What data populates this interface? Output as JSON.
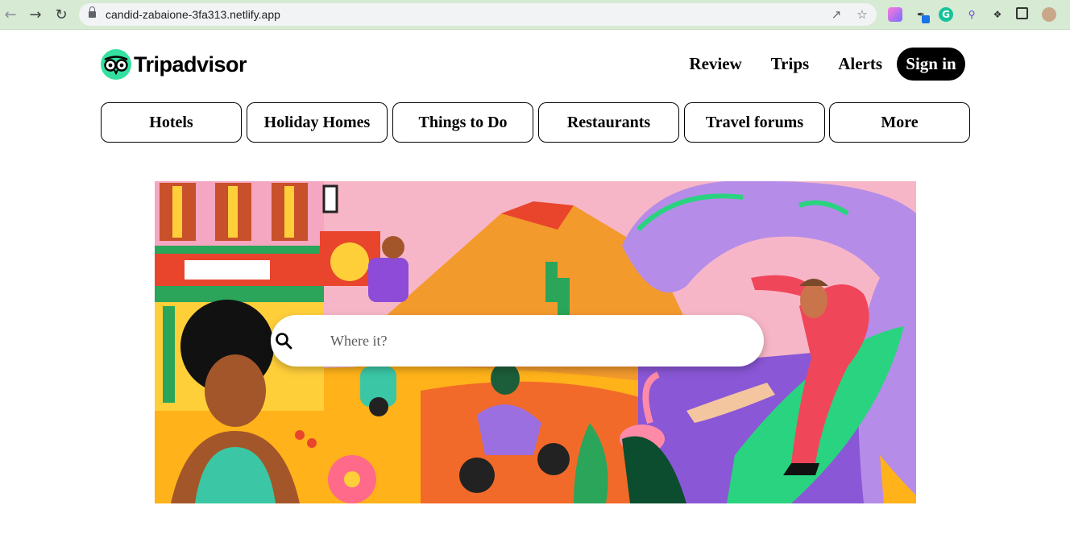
{
  "browser": {
    "url": "candid-zabaione-3fa313.netlify.app",
    "back_icon": "back-arrow-icon",
    "forward_icon": "forward-arrow-icon",
    "reload_icon": "reload-icon",
    "colors": {
      "chrome": "#d6ead4",
      "omnibox": "#f1f3f4"
    }
  },
  "header": {
    "logo_text": "Tripadvisor",
    "logo_color": "#34e0a1",
    "nav": [
      "Review",
      "Trips",
      "Alerts"
    ],
    "signin_label": "Sign in"
  },
  "categories": [
    "Hotels",
    "Holiday Homes",
    "Things to Do",
    "Restaurants",
    "Travel forums",
    "More"
  ],
  "hero": {
    "search_placeholder": "Where it?",
    "search_icon": "search-icon"
  }
}
